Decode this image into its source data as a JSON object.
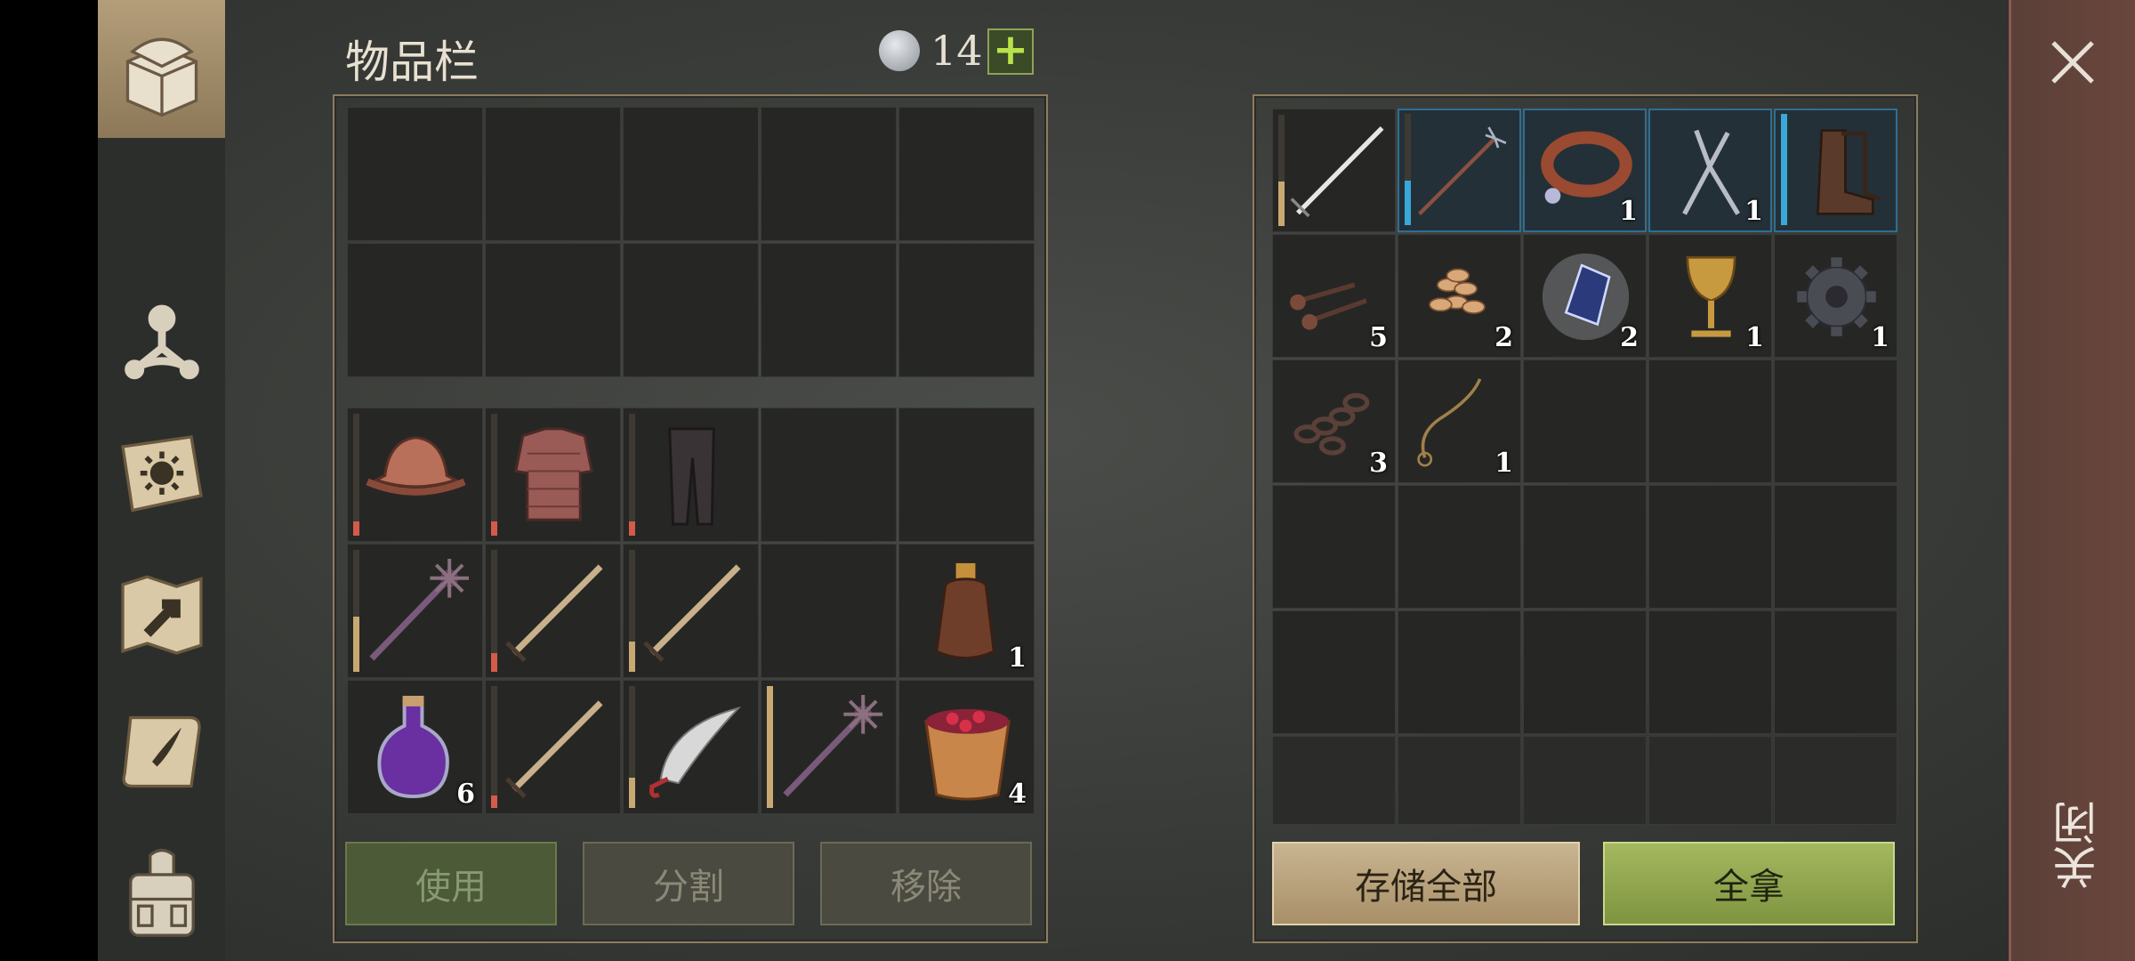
{
  "header": {
    "title": "物品栏",
    "currency_value": "14",
    "add_label": "+"
  },
  "nav": [
    {
      "name": "chest-icon"
    },
    {
      "name": "crafting-icon"
    },
    {
      "name": "sun-book-icon"
    },
    {
      "name": "map-icon"
    },
    {
      "name": "scroll-icon"
    },
    {
      "name": "backpack-icon"
    }
  ],
  "inventory": {
    "storage_rows": [
      [
        "",
        "",
        "",
        "",
        ""
      ],
      [
        "",
        "",
        "",
        "",
        ""
      ]
    ],
    "equipment": [
      {
        "item": "helmet-icon",
        "qty": "",
        "durability": 0.12,
        "dur_color": "#d45a4a"
      },
      {
        "item": "chainmail-icon",
        "qty": "",
        "durability": 0.12,
        "dur_color": "#d45a4a"
      },
      {
        "item": "pants-icon",
        "qty": "",
        "durability": 0.12,
        "dur_color": "#d45a4a"
      },
      {
        "item": "",
        "qty": ""
      },
      {
        "item": "",
        "qty": ""
      },
      {
        "item": "mace-icon",
        "qty": "",
        "durability": 0.45,
        "dur_color": "#c8a971"
      },
      {
        "item": "sword-icon",
        "qty": "",
        "durability": 0.15,
        "dur_color": "#d45a4a"
      },
      {
        "item": "sword-icon",
        "qty": "",
        "durability": 0.25,
        "dur_color": "#c8a971"
      },
      {
        "item": "",
        "qty": ""
      },
      {
        "item": "bottle-icon",
        "qty": "1"
      },
      {
        "item": "potion-icon",
        "qty": "6"
      },
      {
        "item": "sword-icon",
        "qty": "",
        "durability": 0.1,
        "dur_color": "#d45a4a"
      },
      {
        "item": "scimitar-icon",
        "qty": "",
        "durability": 0.25,
        "dur_color": "#c8a971"
      },
      {
        "item": "mace-icon",
        "qty": "",
        "durability": 1.0,
        "dur_color": "#c8a971"
      },
      {
        "item": "berry-bucket-icon",
        "qty": "4"
      }
    ]
  },
  "loot": {
    "items": [
      {
        "item": "longsword-icon",
        "qty": "",
        "durability": 0.4,
        "dur_color": "#c8a971",
        "hl": false
      },
      {
        "item": "pitchfork-icon",
        "qty": "",
        "durability": 0.4,
        "dur_color": "#3aa8d8",
        "hl": true
      },
      {
        "item": "collar-icon",
        "qty": "1",
        "hl": true
      },
      {
        "item": "pliers-icon",
        "qty": "1",
        "hl": true
      },
      {
        "item": "boots-icon",
        "qty": "",
        "durability": 1.0,
        "dur_color": "#3aa8d8",
        "hl": true
      },
      {
        "item": "nails-icon",
        "qty": "5"
      },
      {
        "item": "seeds-icon",
        "qty": "2"
      },
      {
        "item": "crystal-icon",
        "qty": "2"
      },
      {
        "item": "goblet-icon",
        "qty": "1"
      },
      {
        "item": "gear-icon",
        "qty": "1"
      },
      {
        "item": "chain-icon",
        "qty": "3"
      },
      {
        "item": "rope-icon",
        "qty": "1"
      },
      {
        "item": "",
        "qty": ""
      },
      {
        "item": "",
        "qty": ""
      },
      {
        "item": "",
        "qty": ""
      },
      {
        "item": "",
        "qty": ""
      },
      {
        "item": "",
        "qty": ""
      },
      {
        "item": "",
        "qty": ""
      },
      {
        "item": "",
        "qty": ""
      },
      {
        "item": "",
        "qty": ""
      },
      {
        "item": "",
        "qty": ""
      },
      {
        "item": "",
        "qty": ""
      },
      {
        "item": "",
        "qty": ""
      },
      {
        "item": "",
        "qty": ""
      },
      {
        "item": "",
        "qty": ""
      },
      {
        "item": "",
        "qty": ""
      },
      {
        "item": "",
        "qty": ""
      },
      {
        "item": "",
        "qty": ""
      },
      {
        "item": "",
        "qty": ""
      },
      {
        "item": "",
        "qty": ""
      }
    ]
  },
  "actions": {
    "use": "使用",
    "split": "分割",
    "remove": "移除",
    "store_all": "存储全部",
    "take_all": "全拿"
  },
  "close": {
    "label": "关闭"
  }
}
